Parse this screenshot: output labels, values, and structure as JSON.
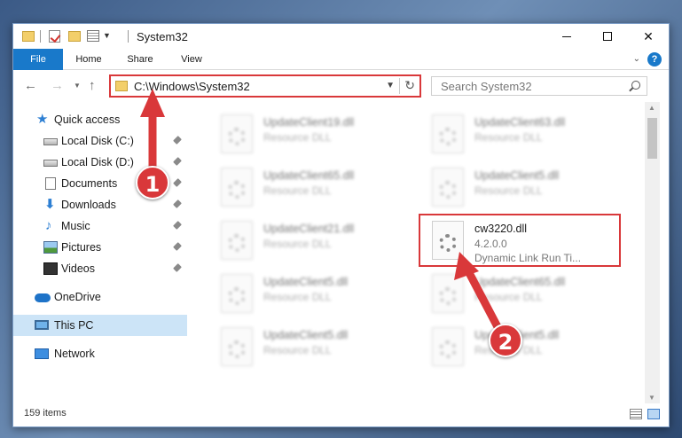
{
  "window": {
    "title": "System32",
    "min_glyph": "",
    "max_glyph": "",
    "close_glyph": "✕"
  },
  "ribbon": {
    "tabs": [
      "File",
      "Home",
      "Share",
      "View"
    ],
    "help": "?"
  },
  "address_bar": {
    "path": "C:\\Windows\\System32"
  },
  "search": {
    "placeholder": "Search System32"
  },
  "nav_pane": {
    "items": [
      {
        "label": "Quick access",
        "icon": "star-icon",
        "pinned": false
      },
      {
        "label": "Local Disk (C:)",
        "icon": "drive-icon",
        "pinned": true
      },
      {
        "label": "Local Disk (D:)",
        "icon": "drive-icon",
        "pinned": true
      },
      {
        "label": "Documents",
        "icon": "document-icon",
        "pinned": true
      },
      {
        "label": "Downloads",
        "icon": "download-icon",
        "pinned": true
      },
      {
        "label": "Music",
        "icon": "music-icon",
        "pinned": true
      },
      {
        "label": "Pictures",
        "icon": "pictures-icon",
        "pinned": true
      },
      {
        "label": "Videos",
        "icon": "video-icon",
        "pinned": true
      },
      {
        "label": "OneDrive",
        "icon": "cloud-icon",
        "pinned": false
      },
      {
        "label": "This PC",
        "icon": "computer-icon",
        "pinned": false,
        "selected": true
      },
      {
        "label": "Network",
        "icon": "network-icon",
        "pinned": false
      }
    ]
  },
  "files": [
    {
      "name": "UpdateClient19.dll",
      "type": "Resource DLL"
    },
    {
      "name": "UpdateClient63.dll",
      "type": "Resource DLL"
    },
    {
      "name": "UpdateClient65.dll",
      "type": "Resource DLL"
    },
    {
      "name": "UpdateClient5.dll",
      "type": "Resource DLL"
    },
    {
      "name": "UpdateClient21.dll",
      "type": "Resource DLL"
    },
    {
      "name": "cw3220.dll",
      "version": "4.2.0.0",
      "description": "Dynamic Link Run Ti..."
    },
    {
      "name": "UpdateClient5.dll",
      "type": "Resource DLL"
    },
    {
      "name": "UpdateClient65.dll",
      "type": "Resource DLL"
    },
    {
      "name": "UpdateClient5.dll",
      "type": "Resource DLL"
    },
    {
      "name": "UpdateClient5.dll",
      "type": "Resource DLL"
    }
  ],
  "status": {
    "item_count": "159 items"
  },
  "annotations": {
    "step1": "1",
    "step2": "2",
    "color": "#d9383a"
  }
}
